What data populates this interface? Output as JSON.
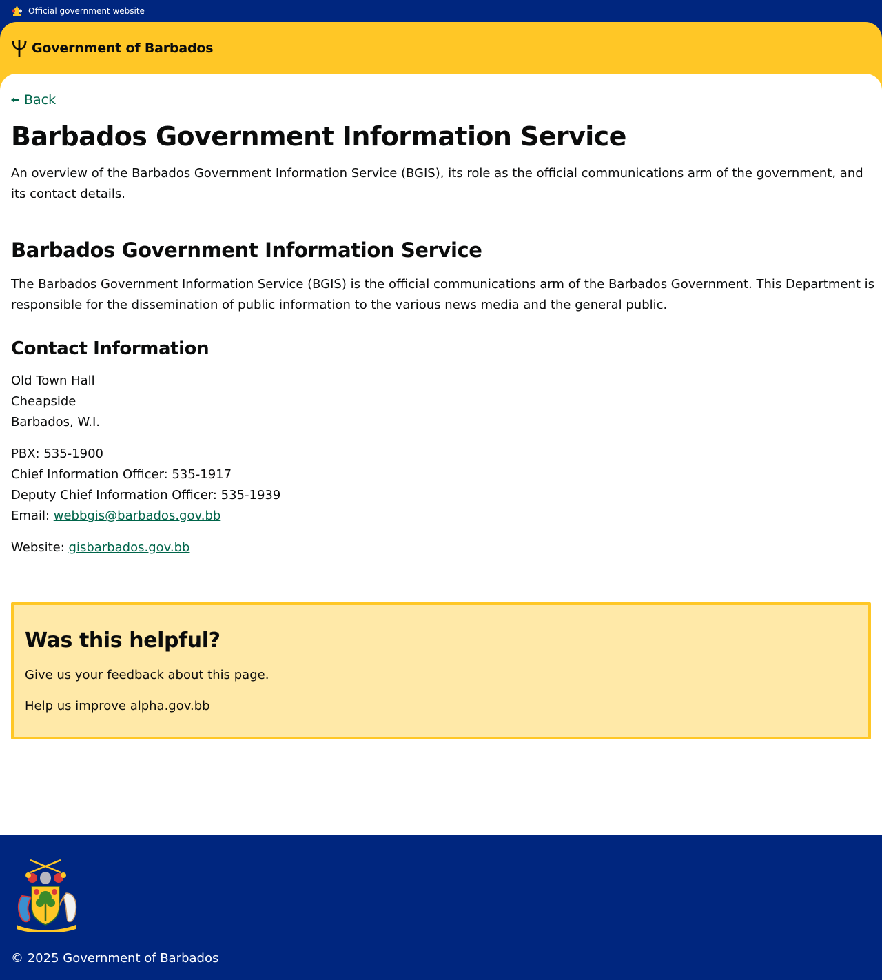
{
  "official_banner": {
    "text": "Official government website",
    "crest_icon": "coat-of-arms-icon"
  },
  "header": {
    "brand_text": "Government of Barbados",
    "brand_icon": "trident-icon",
    "background_color": "#ffc726"
  },
  "nav": {
    "back_label": "Back",
    "back_icon": "arrow-left-icon"
  },
  "page": {
    "title": "Barbados Government Information Service",
    "lead": "An overview of the Barbados Government Information Service (BGIS), its role as the official communications arm of the government, and its contact details."
  },
  "section": {
    "heading": "Barbados Government Information Service",
    "body": "The Barbados Government Information Service (BGIS) is the official communications arm of the Barbados Government. This Department is responsible for the dissemination of public information to the various news media and the general public."
  },
  "contact": {
    "heading": "Contact Information",
    "address": [
      "Old Town Hall",
      "Cheapside",
      "Barbados, W.I."
    ],
    "pbx": "PBX: 535-1900",
    "chief_officer": "Chief Information Officer: 535-1917",
    "deputy_officer": "Deputy Chief Information Officer: 535-1939",
    "email_label": "Email: ",
    "email": "webbgis@barbados.gov.bb",
    "website_label": "Website: ",
    "website": "gisbarbados.gov.bb"
  },
  "feedback": {
    "title": "Was this helpful?",
    "text": "Give us your feedback about this page.",
    "link": "Help us improve alpha.gov.bb"
  },
  "footer": {
    "crest_icon": "coat-of-arms-icon",
    "copyright": "© 2025 Government of Barbados"
  },
  "colors": {
    "navy": "#00267f",
    "gold": "#ffc726",
    "link": "#00654a",
    "feedback_bg": "#ffe9a8"
  }
}
